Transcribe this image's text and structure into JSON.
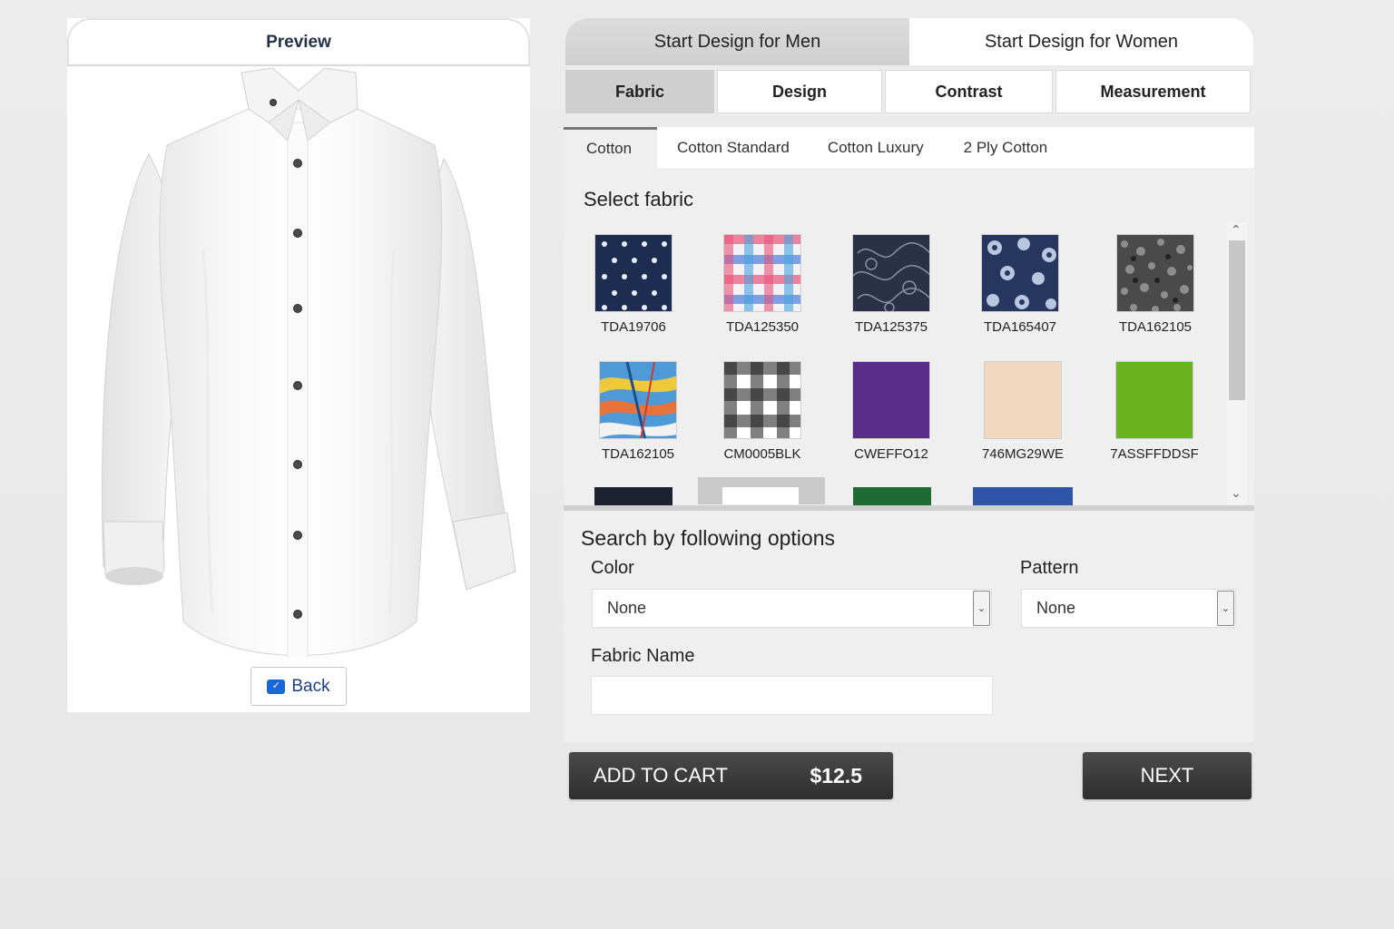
{
  "preview": {
    "title": "Preview",
    "back_label": "Back",
    "back_icon": "back-arrow-icon"
  },
  "gender_tabs": [
    {
      "label": "Start Design for Men",
      "active": true
    },
    {
      "label": "Start Design for Women",
      "active": false
    }
  ],
  "sub_tabs": [
    {
      "label": "Fabric",
      "active": true
    },
    {
      "label": "Design",
      "active": false
    },
    {
      "label": "Contrast",
      "active": false
    },
    {
      "label": "Measurement",
      "active": false
    }
  ],
  "fabric_types": [
    {
      "label": "Cotton",
      "active": true
    },
    {
      "label": "Cotton Standard",
      "active": false
    },
    {
      "label": "Cotton Luxury",
      "active": false
    },
    {
      "label": "2 Ply Cotton",
      "active": false
    }
  ],
  "fabric_section": {
    "title": "Select fabric",
    "swatches": [
      {
        "code": "TDA19706",
        "pattern": "polka-dot",
        "color": "#1d2d52"
      },
      {
        "code": "TDA125350",
        "pattern": "check-multicolor",
        "color": "#e8567c"
      },
      {
        "code": "TDA125375",
        "pattern": "paisley",
        "color": "#2b3247"
      },
      {
        "code": "TDA165407",
        "pattern": "floral",
        "color": "#26365f"
      },
      {
        "code": "TDA162105",
        "pattern": "texture",
        "color": "#4a4a4a"
      },
      {
        "code": "TDA162105",
        "pattern": "abstract-multicolor",
        "color": "#4d9ad6"
      },
      {
        "code": "CM0005BLK",
        "pattern": "gingham",
        "color": "#1a1a1a"
      },
      {
        "code": "CWEFFO12",
        "pattern": "solid",
        "color": "#5b2d8a"
      },
      {
        "code": "746MG29WE",
        "pattern": "solid",
        "color": "#f2d8c0"
      },
      {
        "code": "7ASSFFDDSF",
        "pattern": "solid",
        "color": "#6ab51f"
      }
    ],
    "partial_swatches": [
      {
        "color": "#1c2230"
      },
      {
        "color": "#ffffff"
      },
      {
        "color": "#1f6b34"
      },
      {
        "color": "#2f55a8"
      }
    ]
  },
  "search": {
    "title": "Search by following options",
    "color_label": "Color",
    "color_value": "None",
    "pattern_label": "Pattern",
    "pattern_value": "None",
    "fabric_name_label": "Fabric Name",
    "fabric_name_value": ""
  },
  "actions": {
    "add_to_cart_label": "ADD TO CART",
    "price": "$12.5",
    "next_label": "NEXT"
  }
}
